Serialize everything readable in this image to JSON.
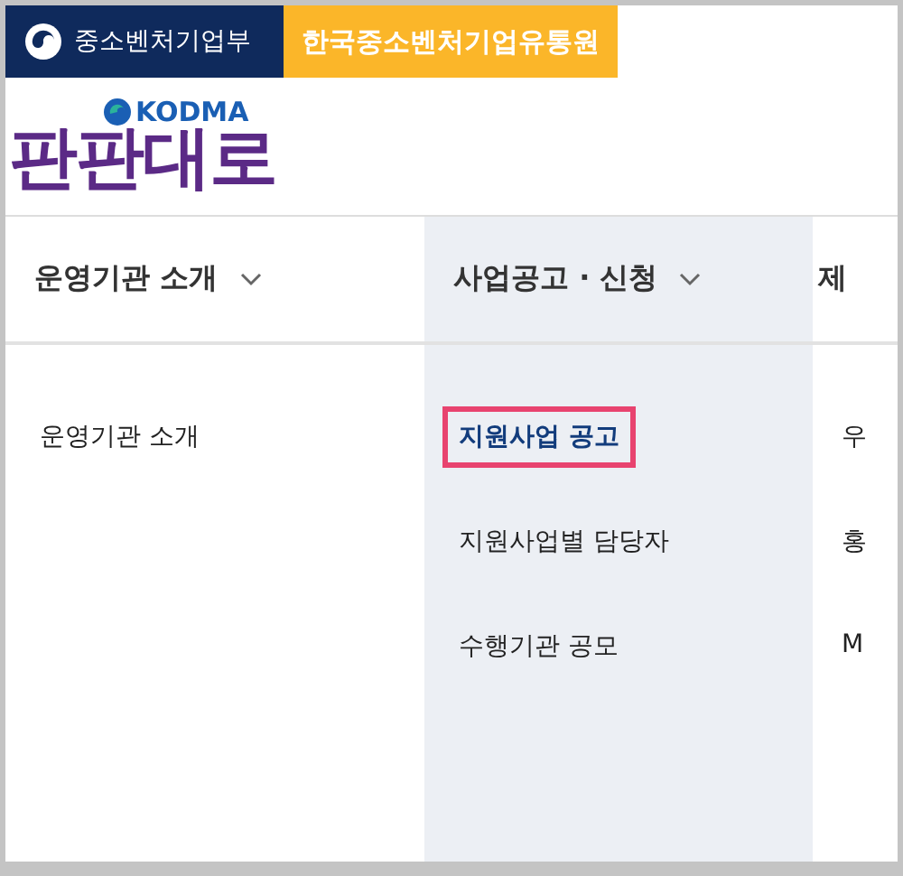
{
  "top_bar": {
    "ministry": "중소벤처기업부",
    "agency": "한국중소벤처기업유통원"
  },
  "logo": {
    "badge": "KODMA",
    "wordmark": "판판대로"
  },
  "menus": [
    {
      "label": "운영기관 소개",
      "selected": false,
      "chevron": true,
      "items": [
        {
          "label": "운영기관 소개",
          "selected": false
        }
      ]
    },
    {
      "label": "사업공고 · 신청",
      "selected": true,
      "chevron": true,
      "items": [
        {
          "label": "지원사업 공고",
          "selected": true
        },
        {
          "label": "지원사업별 담당자",
          "selected": false
        },
        {
          "label": "수행기관 공모",
          "selected": false
        }
      ]
    },
    {
      "label": "제",
      "selected": false,
      "chevron": false,
      "items": [
        {
          "label": "우",
          "selected": false
        },
        {
          "label": "홍",
          "selected": false
        },
        {
          "label": "M",
          "selected": false
        }
      ]
    }
  ]
}
